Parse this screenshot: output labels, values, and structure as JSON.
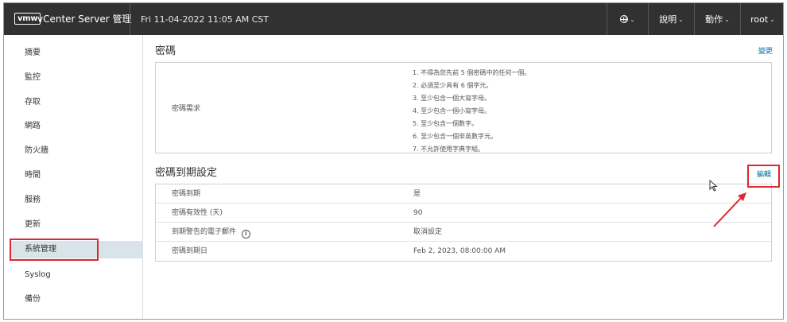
{
  "header": {
    "logo": "vmw",
    "app_title": "vCenter Server 管理",
    "datetime": "Fri 11-04-2022 11:05 AM CST",
    "help_label": "說明",
    "actions_label": "動作",
    "user_label": "root",
    "caret": "⌄"
  },
  "sidebar": {
    "items": [
      {
        "label": "摘要"
      },
      {
        "label": "監控"
      },
      {
        "label": "存取"
      },
      {
        "label": "網路"
      },
      {
        "label": "防火牆"
      },
      {
        "label": "時間"
      },
      {
        "label": "服務"
      },
      {
        "label": "更新"
      },
      {
        "label": "系統管理",
        "active": true
      },
      {
        "label": "Syslog"
      },
      {
        "label": "備份"
      }
    ]
  },
  "password": {
    "title": "密碼",
    "change_label": "變更",
    "requirements_label": "密碼需求",
    "rules": [
      "1. 不得為您先前 5 個密碼中的任何一個。",
      "2. 必須至少具有 6 個字元。",
      "3. 至少包含一個大寫字母。",
      "4. 至少包含一個小寫字母。",
      "5. 至少包含一個數字。",
      "6. 至少包含一個非英數字元。",
      "7. 不允許使用字典字組。"
    ]
  },
  "expiration": {
    "title": "密碼到期設定",
    "edit_label": "編輯",
    "rows": [
      {
        "key": "密碼到期",
        "value": "是"
      },
      {
        "key": "密碼有效性 (天)",
        "value": "90"
      },
      {
        "key": "到期警告的電子郵件",
        "value": "取消設定",
        "info_icon": "ⓘ"
      },
      {
        "key": "密碼到期日",
        "value": "Feb 2, 2023, 08:00:00 AM"
      }
    ]
  },
  "colors": {
    "header_bg": "#313131",
    "link": "#0072a3",
    "highlight": "#e0262f",
    "active_nav": "#d9e4ea"
  }
}
